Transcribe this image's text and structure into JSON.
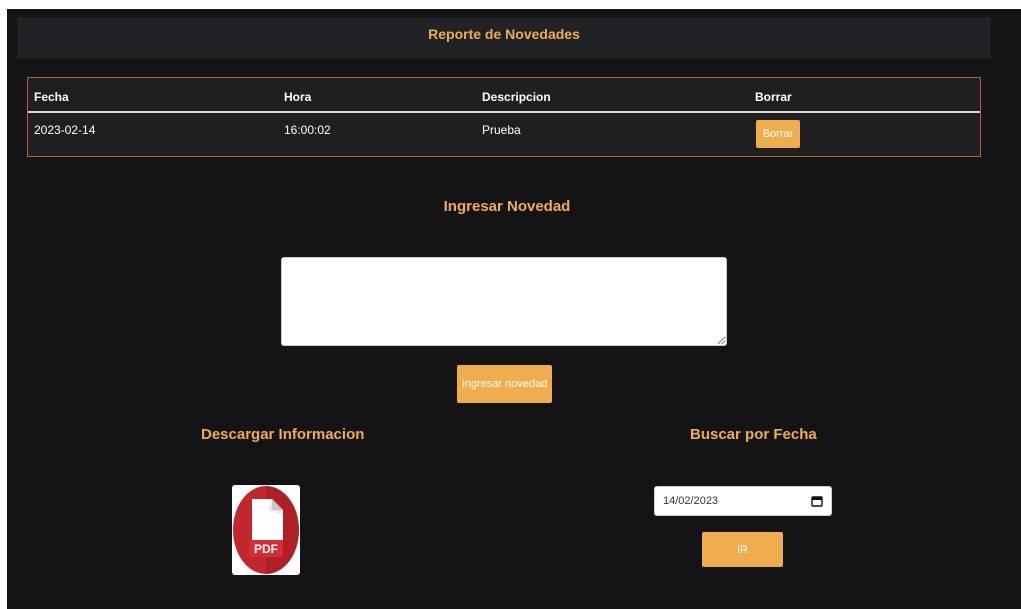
{
  "header": {
    "title": "Reporte de Novedades"
  },
  "table": {
    "columns": [
      "Fecha",
      "Hora",
      "Descripcion",
      "Borrar"
    ],
    "rows": [
      {
        "fecha": "2023-02-14",
        "hora": "16:00:02",
        "descripcion": "Prueba",
        "action_label": "Borrar"
      }
    ]
  },
  "ingresar": {
    "title": "Ingresar Novedad",
    "textarea_value": "",
    "button_label": "Ingresar novedad"
  },
  "descargar": {
    "title": "Descargar Informacion",
    "icon": "pdf-file-icon",
    "icon_text": "PDF"
  },
  "buscar": {
    "title": "Buscar por Fecha",
    "date_value": "14/02/2023",
    "button_label": "IR"
  },
  "colors": {
    "accent": "#f0ad4e",
    "background": "#141417",
    "header_bg": "#212225",
    "table_border": "#b5651d",
    "pdf_red": "#c1272d"
  }
}
